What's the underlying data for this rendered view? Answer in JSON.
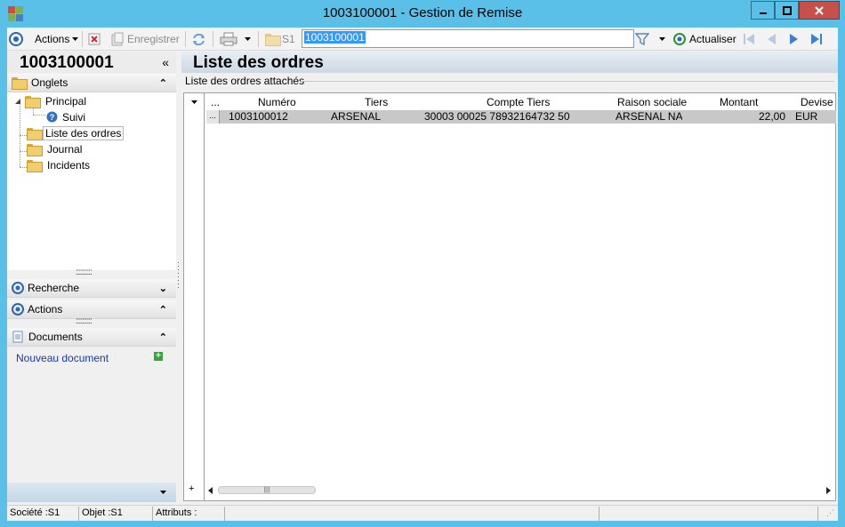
{
  "window": {
    "title": "1003100001 -  Gestion de Remise"
  },
  "toolbar": {
    "actions_label": "Actions",
    "save_label": "Enregistrer",
    "s1_label": "S1",
    "search_value": "1003100001",
    "refresh_label": "Actualiser"
  },
  "left": {
    "record_title": "1003100001",
    "collapse_glyph": "«",
    "onglets_label": "Onglets",
    "tree": {
      "principal": "Principal",
      "suivi": "Suivi",
      "liste_ordres": "Liste des ordres",
      "journal": "Journal",
      "incidents": "Incidents"
    },
    "recherche_label": "Recherche",
    "actions_label": "Actions",
    "documents_label": "Documents",
    "new_document_label": "Nouveau document"
  },
  "right": {
    "title": "Liste des ordres",
    "group_label": "Liste des ordres attachés",
    "columns": {
      "dots": "...",
      "numero": "Numéro",
      "tiers": "Tiers",
      "compte_tiers": "Compte Tiers",
      "raison_sociale": "Raison sociale",
      "montant": "Montant",
      "devise": "Devise"
    },
    "rows": [
      {
        "selector": "...",
        "numero": "1003100012",
        "tiers": "ARSENAL",
        "compte_tiers": "30003 00025 78932164732 50",
        "raison_sociale": "ARSENAL  NAV",
        "montant": "22,00",
        "devise": "EUR"
      }
    ],
    "add_row_glyph": "+"
  },
  "status": {
    "societe": "Société :S1",
    "objet": "Objet :S1",
    "attributs": "Attributs :"
  },
  "colors": {
    "window_frame": "#5bc0e8",
    "close_button": "#c7504b",
    "selection": "#3399ff",
    "row_selected": "#c8c8c8"
  }
}
